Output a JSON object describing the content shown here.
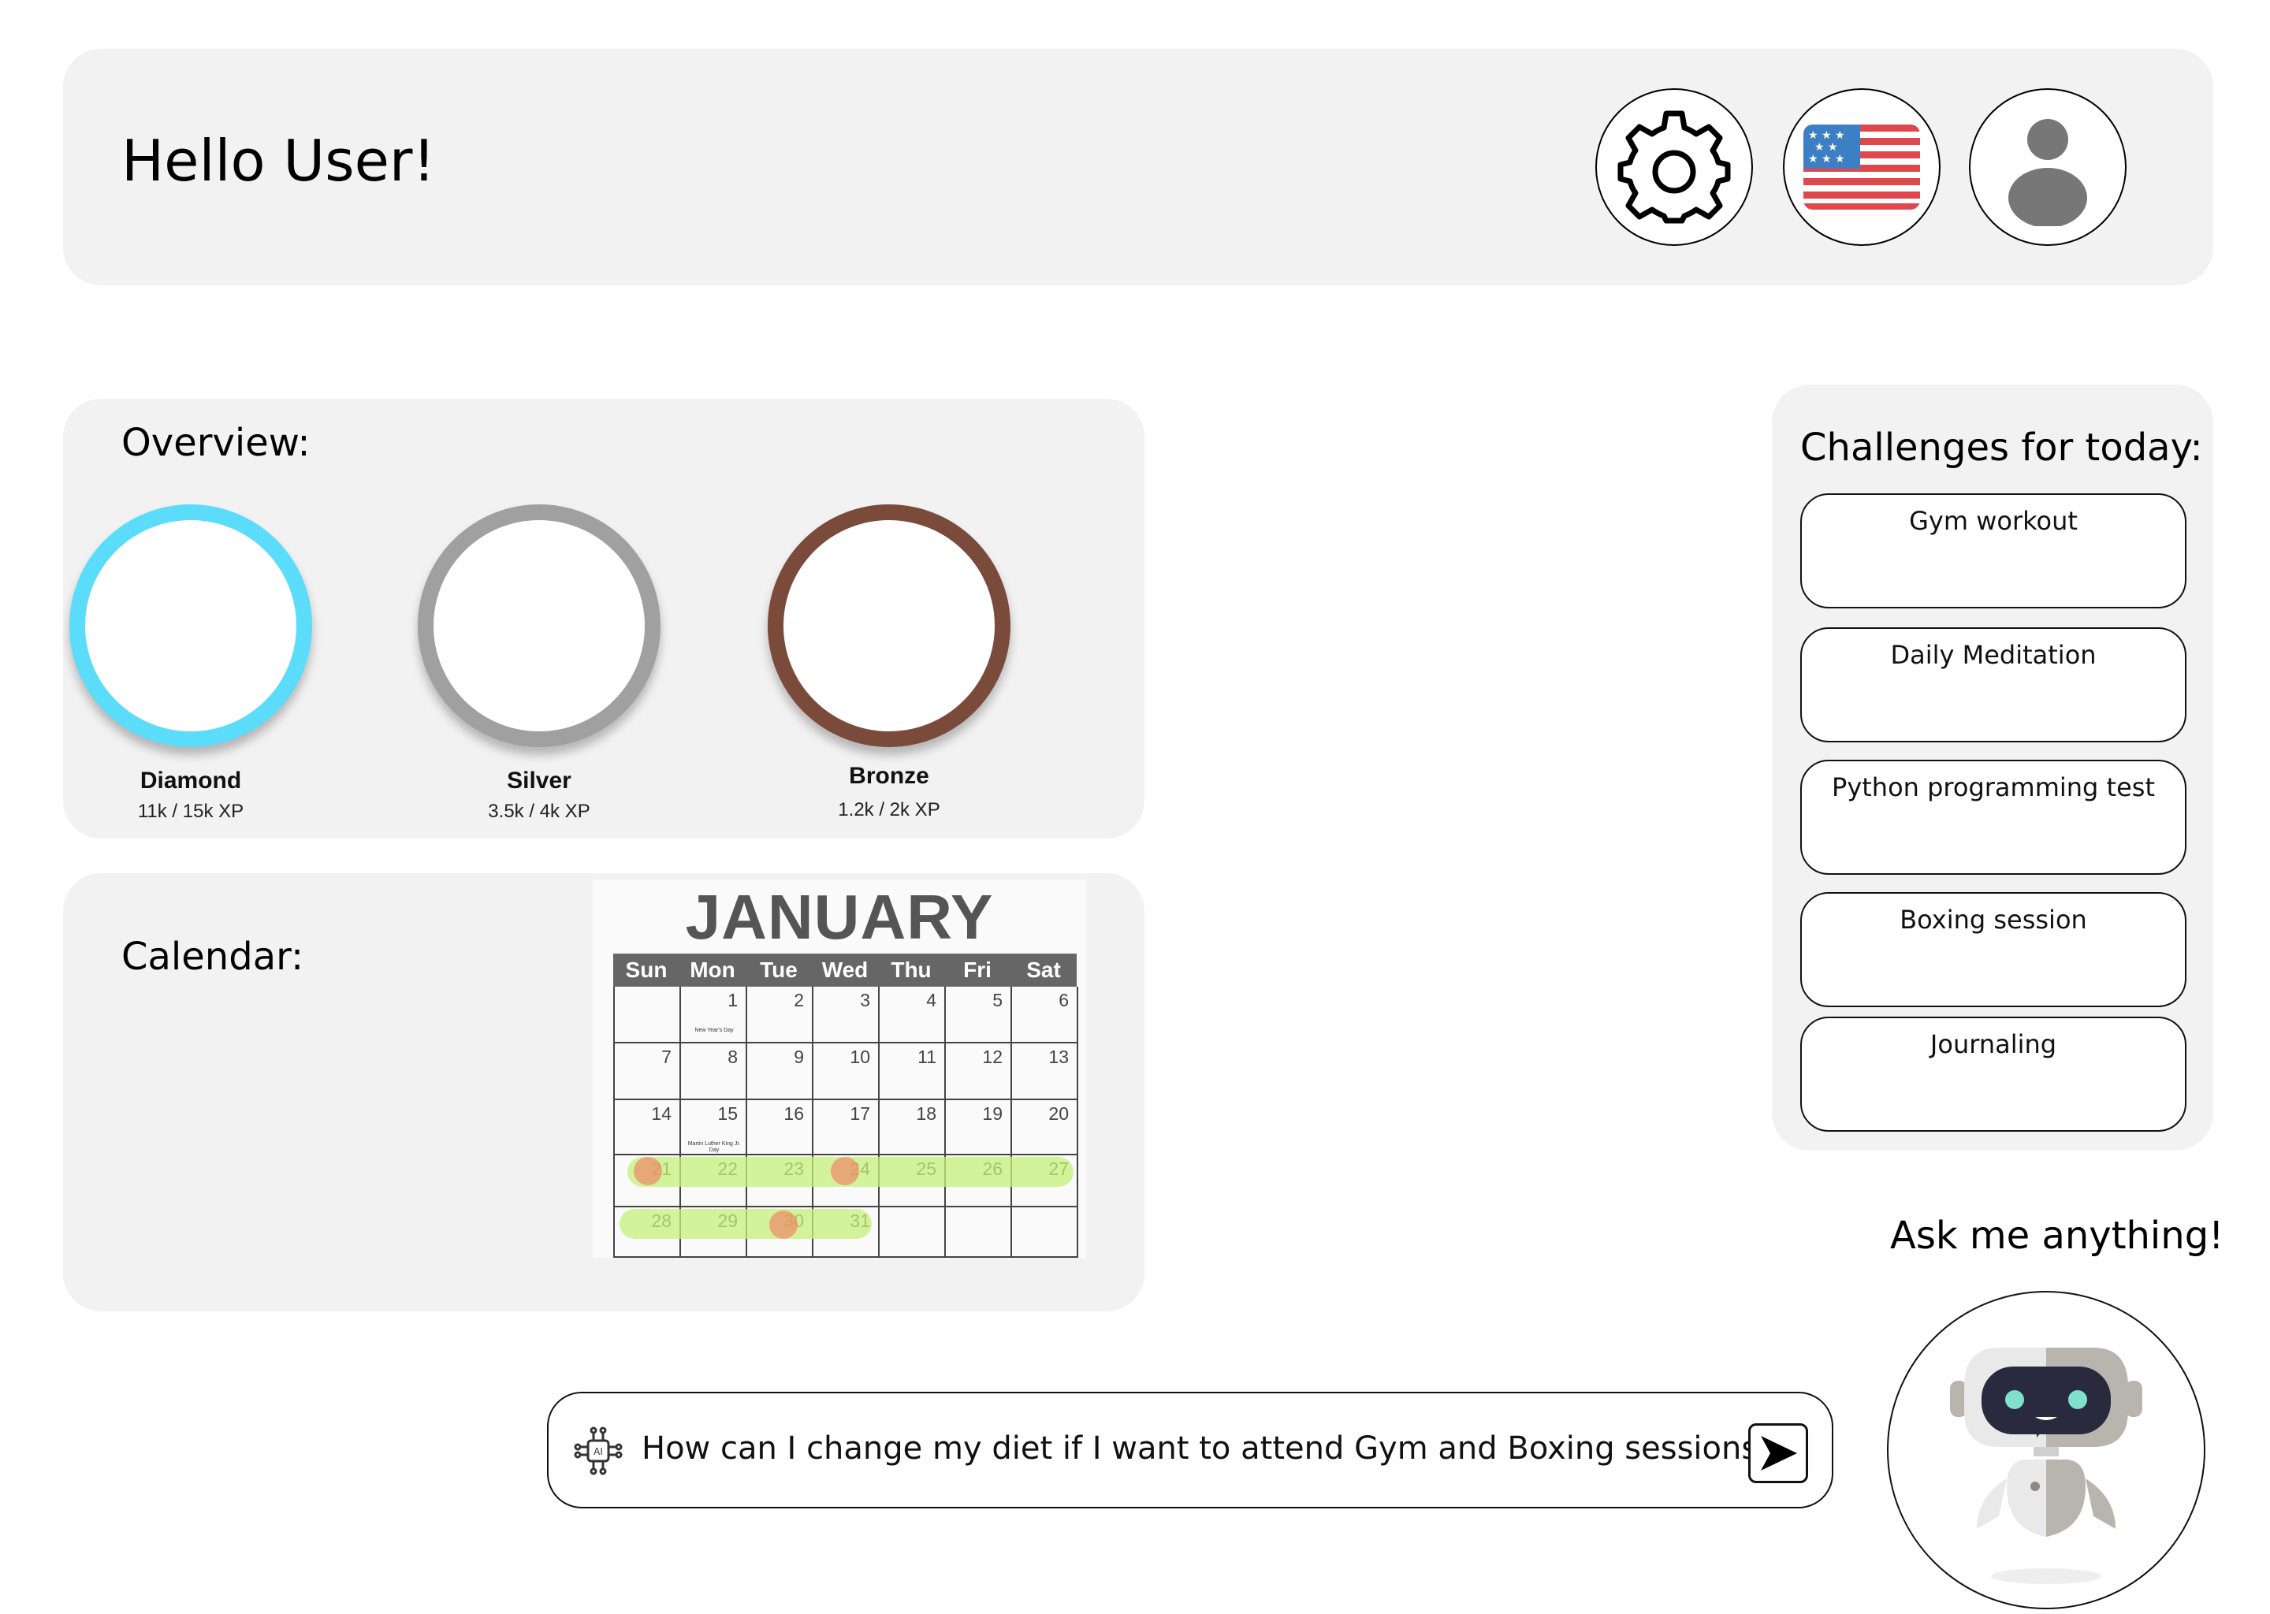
{
  "header": {
    "greeting": "Hello User!",
    "settings_icon": "gear-icon",
    "language_icon": "us-flag-icon",
    "profile_icon": "user-avatar-icon"
  },
  "overview": {
    "title": "Overview:",
    "medals": [
      {
        "name": "Diamond",
        "xp": "11k / 15k XP",
        "color": "#5bdcfb"
      },
      {
        "name": "Silver",
        "xp": "3.5k / 4k XP",
        "color": "#a0a0a0"
      },
      {
        "name": "Bronze",
        "xp": "1.2k / 2k XP",
        "color": "#7a4a3a"
      }
    ]
  },
  "calendar": {
    "title": "Calendar:",
    "month": "JANUARY",
    "weekdays": [
      "Sun",
      "Mon",
      "Tue",
      "Wed",
      "Thu",
      "Fri",
      "Sat"
    ],
    "weeks": [
      [
        "",
        "1",
        "2",
        "3",
        "4",
        "5",
        "6"
      ],
      [
        "7",
        "8",
        "9",
        "10",
        "11",
        "12",
        "13"
      ],
      [
        "14",
        "15",
        "16",
        "17",
        "18",
        "19",
        "20"
      ],
      [
        "21",
        "22",
        "23",
        "24",
        "25",
        "26",
        "27"
      ],
      [
        "28",
        "29",
        "30",
        "31",
        "",
        "",
        ""
      ]
    ],
    "notes": {
      "1": "New Year's Day",
      "15": "Martin Luther King Jr. Day"
    },
    "highlight_color": "#c6f07a",
    "marker_color": "#ec8f6a"
  },
  "challenges": {
    "title": "Challenges for today:",
    "items": [
      "Gym workout",
      "Daily Meditation",
      "Python programming test",
      "Boxing session",
      "Journaling"
    ]
  },
  "assistant": {
    "title": "Ask me anything!",
    "icon": "robot-icon"
  },
  "chat": {
    "message": "How can I change my diet if I want to attend Gym and Boxing sessions ?",
    "ai_icon": "ai-chip-icon",
    "send_icon": "send-icon"
  }
}
